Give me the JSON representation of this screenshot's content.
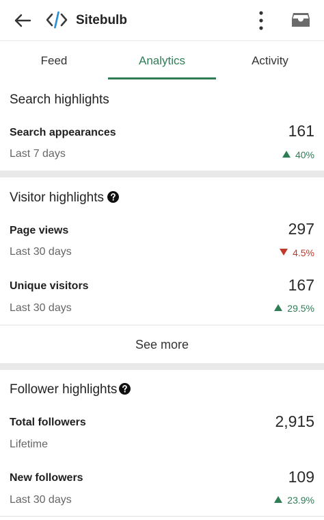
{
  "header": {
    "title": "Sitebulb",
    "icons": {
      "back": "back-arrow-icon",
      "logo": "code-brackets-icon",
      "more": "more-vertical-icon",
      "inbox": "inbox-icon"
    }
  },
  "tabs": [
    {
      "label": "Feed",
      "active": false
    },
    {
      "label": "Analytics",
      "active": true
    },
    {
      "label": "Activity",
      "active": false
    }
  ],
  "search_highlights": {
    "title": "Search highlights",
    "metrics": [
      {
        "label": "Search appearances",
        "period": "Last 7 days",
        "value": "161",
        "change": "40%",
        "direction": "up"
      }
    ]
  },
  "visitor_highlights": {
    "title": "Visitor highlights",
    "metrics": [
      {
        "label": "Page views",
        "period": "Last 30 days",
        "value": "297",
        "change": "4.5%",
        "direction": "down"
      },
      {
        "label": "Unique visitors",
        "period": "Last 30 days",
        "value": "167",
        "change": "29.5%",
        "direction": "up"
      }
    ],
    "see_more": "See more"
  },
  "follower_highlights": {
    "title": "Follower highlights",
    "metrics": [
      {
        "label": "Total followers",
        "period": "Lifetime",
        "value": "2,915"
      },
      {
        "label": "New followers",
        "period": "Last 30 days",
        "value": "109",
        "change": "23.9%",
        "direction": "up"
      }
    ]
  },
  "colors": {
    "accent": "#2e7d55",
    "negative": "#c0392b",
    "divider": "#e9e9e9"
  }
}
